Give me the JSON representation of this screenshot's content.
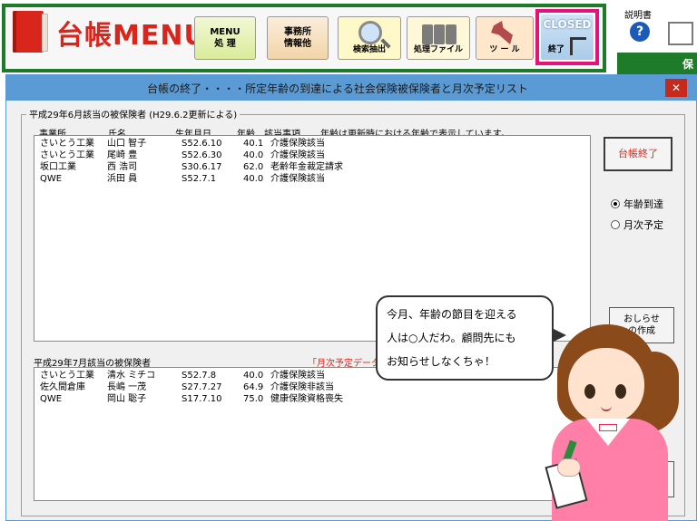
{
  "toolbar": {
    "app_title": "台帳MENU",
    "menu_button": "MENU\n処 理",
    "office_button": "事務所\n情報他",
    "search_label": "検索抽出",
    "files_label": "処理ファイル",
    "tools_label": "ツ ー ル",
    "closed_label": "CLOSED",
    "exit_label": "終了",
    "manual_label": "説明書",
    "help_symbol": "?",
    "right_strip_text": "保",
    "accent_green": "#1e7b2a",
    "accent_pink": "#e4137a"
  },
  "dialog": {
    "title": "台帳の終了・・・・所定年齢の到達による社会保険被保険者と月次予定リスト",
    "close_symbol": "✕",
    "group_label": "平成29年6月該当の被保険者 (H29.6.2更新による)",
    "columns": {
      "office": "事業所",
      "name": "氏名",
      "birth": "生年月日",
      "age": "年齢",
      "matter": "該当事項",
      "note": "年齢は更新時における年齢で表示しています。"
    },
    "june_rows": [
      {
        "office": "さいとう工業",
        "name": "山口 智子",
        "birth": "S52.6.10",
        "age": "40.1",
        "matter": "介護保険該当"
      },
      {
        "office": "さいとう工業",
        "name": "尾崎 豊",
        "birth": "S52.6.30",
        "age": "40.0",
        "matter": "介護保険該当"
      },
      {
        "office": "坂口工業",
        "name": "西 浩司",
        "birth": "S30.6.17",
        "age": "62.0",
        "matter": "老齢年金裁定請求"
      },
      {
        "office": "QWE",
        "name": "浜田 員",
        "birth": "S52.7.1",
        "age": "40.0",
        "matter": "介護保険該当"
      }
    ],
    "july_label": "平成29年7月該当の被保険者",
    "monthly_note": "「月次予定データ」",
    "july_rows": [
      {
        "office": "さいとう工業",
        "name": "清水 ミチコ",
        "birth": "S52.7.8",
        "age": "40.0",
        "matter": "介護保険該当"
      },
      {
        "office": "佐久間倉庫",
        "name": "長嶋 一茂",
        "birth": "S27.7.27",
        "age": "64.9",
        "matter": "介護保険非該当"
      },
      {
        "office": "QWE",
        "name": "岡山 聡子",
        "birth": "S17.7.10",
        "age": "75.0",
        "matter": "健康保険資格喪失"
      }
    ],
    "end_ledger_button": "台帳終了",
    "radio_age": "年齢到達",
    "radio_monthly": "月次予定",
    "notice_button": "おしらせ\nの作成"
  },
  "speech": {
    "line1": "今月、年齢の節目を迎える",
    "line2": "人は○人だわ。顧問先にも",
    "line3": "お知らせしなくちゃ！"
  }
}
